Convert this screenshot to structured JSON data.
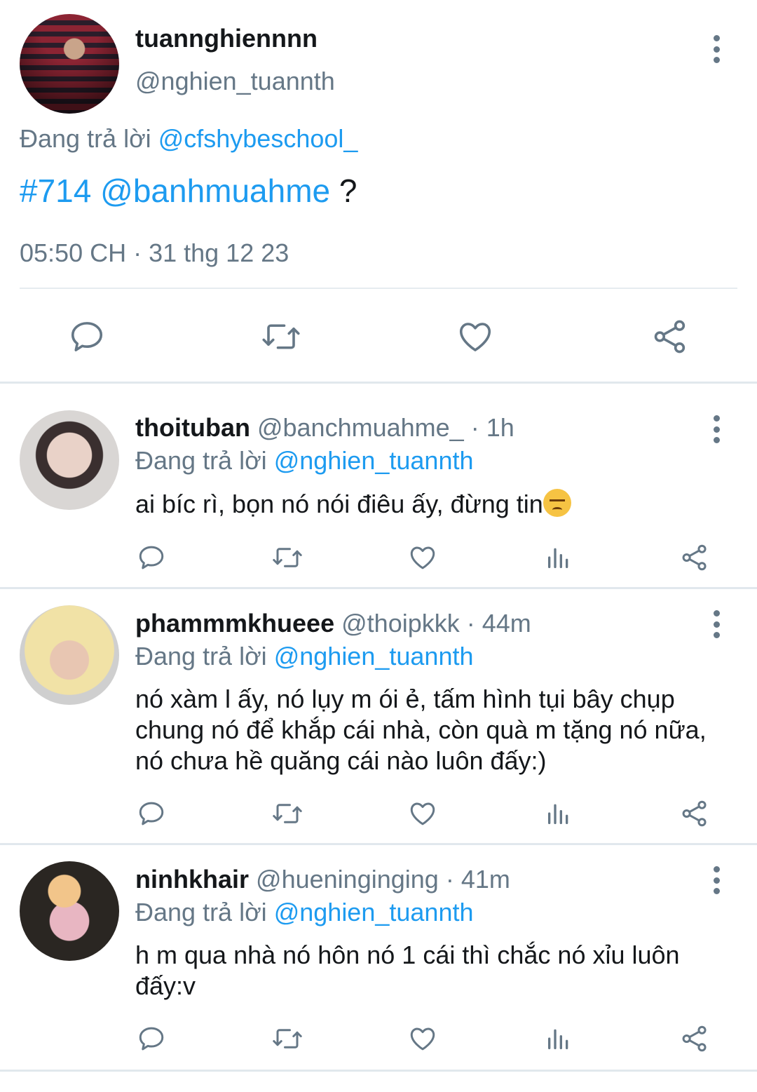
{
  "main_tweet": {
    "display_name": "tuannghiennnn",
    "handle": "@nghien_tuannth",
    "reply_prefix": "Đang trả lời",
    "reply_to": "@cfshybeschool_",
    "hashtag": "#714",
    "mention": "@banhmuahme",
    "text_suffix": " ?",
    "timestamp": "05:50 CH · 31 thg 12 23",
    "actions": [
      "reply-icon",
      "retweet-icon",
      "like-icon",
      "share-icon"
    ]
  },
  "replies": [
    {
      "display_name": "thoituban",
      "handle": "@banchmuahme_",
      "time": "· 1h",
      "reply_prefix": "Đang trả lời",
      "reply_to": "@nghien_tuannth",
      "text": "ai bíc rì, bọn nó nói điêu ấy, đừng tin",
      "emoji": "angry-cat-emoji"
    },
    {
      "display_name": "phammmkhueee",
      "handle": "@thoipkkk",
      "time": "· 44m",
      "reply_prefix": "Đang trả lời",
      "reply_to": "@nghien_tuannth",
      "text": "nó xàm l ấy, nó lụy m ói ẻ, tấm hình tụi bây chụp chung nó để khắp cái nhà, còn quà m tặng nó nữa, nó chưa hề quăng cái nào luôn đấy:)"
    },
    {
      "display_name": "ninhkhair",
      "handle": "@hueninginging",
      "time": "· 41m",
      "reply_prefix": "Đang trả lời",
      "reply_to": "@nghien_tuannth",
      "text": "h m qua nhà nó hôn nó 1 cái thì chắc nó xỉu luôn đấy:v"
    }
  ],
  "reply_actions": [
    "reply-icon",
    "retweet-icon",
    "like-icon",
    "analytics-icon",
    "share-icon"
  ],
  "colors": {
    "link": "#1d9bf0",
    "muted": "#657786",
    "divider": "#e1e8ed"
  }
}
